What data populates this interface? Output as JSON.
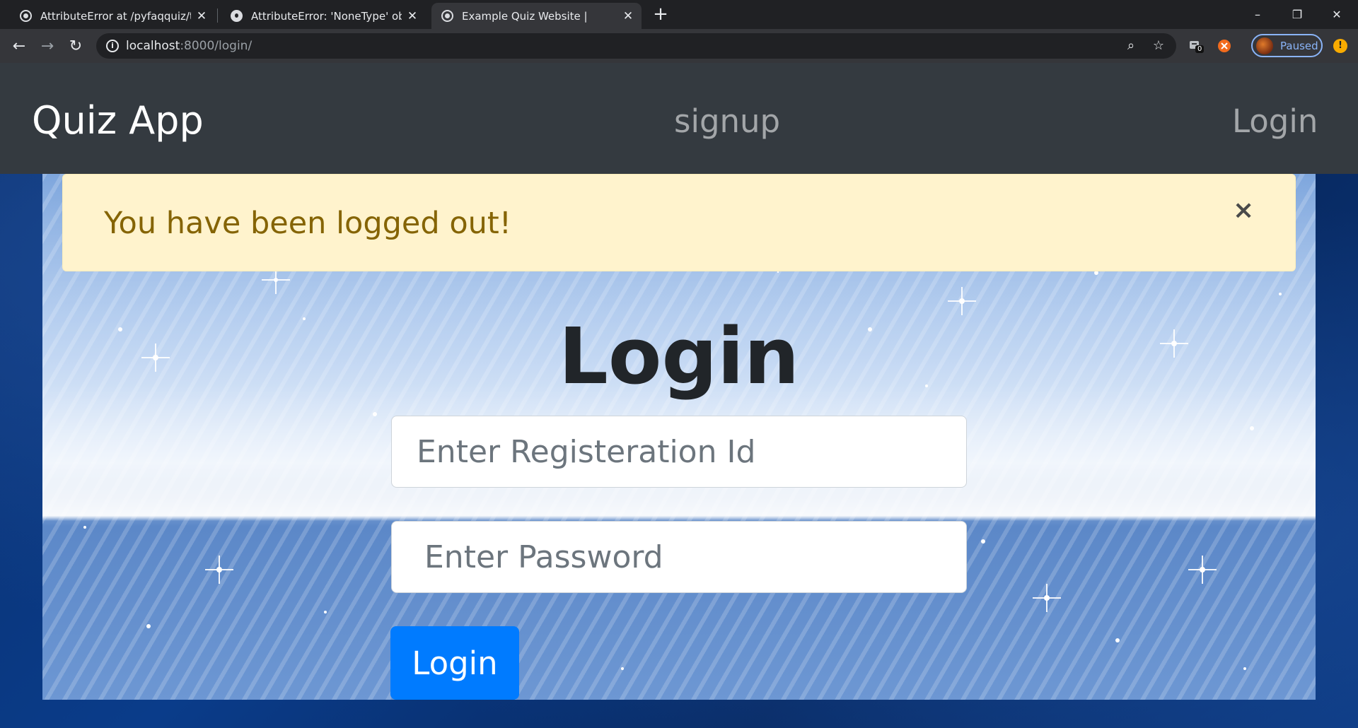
{
  "browser": {
    "tabs": [
      {
        "title": "AttributeError at /pyfaqquiz/take",
        "favicon": "globe-icon"
      },
      {
        "title": "AttributeError: 'NoneType' object",
        "favicon": "github-icon"
      },
      {
        "title": "Example Quiz Website |",
        "favicon": "globe-icon",
        "active": true
      }
    ],
    "new_tab": "+",
    "window_controls": {
      "minimize": "–",
      "restore": "❐",
      "close": "✕"
    },
    "url_host": "localhost",
    "url_path": ":8000/login/",
    "ext_badge": "0",
    "profile_label": "Paused",
    "update_indicator": "!"
  },
  "navbar": {
    "brand": "Quiz App",
    "links": [
      "signup",
      "Login"
    ]
  },
  "alert": {
    "message": "You have been logged out!",
    "close": "×"
  },
  "form": {
    "title": "Login",
    "registration_placeholder": "Enter Registeration Id",
    "password_placeholder": "Enter Password",
    "submit_label": "Login"
  },
  "colors": {
    "navbar_bg": "#343a40",
    "alert_bg": "#fff3cd",
    "alert_text": "#856404",
    "button_bg": "#007bff"
  }
}
